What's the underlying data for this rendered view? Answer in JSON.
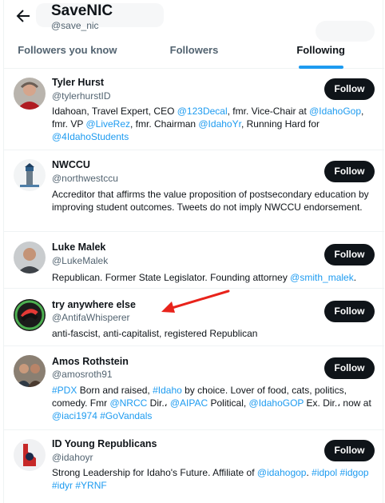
{
  "header": {
    "title": "SaveNIC",
    "handle": "@save_nic"
  },
  "tabs": [
    {
      "label": "Followers you know"
    },
    {
      "label": "Followers"
    },
    {
      "label": "Following"
    }
  ],
  "follow_label": "Follow",
  "users": [
    {
      "name": "Tyler Hurst",
      "handle": "@tylerhurstID",
      "bio": [
        {
          "t": "Idahoan, Travel Expert, CEO "
        },
        {
          "t": "@123Decal",
          "link": true
        },
        {
          "t": ", fmr. Vice-Chair at "
        },
        {
          "t": "@IdahoGop",
          "link": true
        },
        {
          "t": ", fmr. VP "
        },
        {
          "t": "@LiveRez",
          "link": true
        },
        {
          "t": ", fmr. Chairman "
        },
        {
          "t": "@IdahoYr",
          "link": true
        },
        {
          "t": ", Running Hard for "
        },
        {
          "t": "@4IdahoStudents",
          "link": true
        }
      ]
    },
    {
      "name": "NWCCU",
      "handle": "@northwestccu",
      "bio": [
        {
          "t": "Accreditor that affirms the value proposition of postsecondary education by improving student outcomes. Tweets do not imply NWCCU endorsement."
        }
      ]
    },
    {
      "name": "Luke Malek",
      "handle": "@LukeMalek",
      "bio": [
        {
          "t": "Republican. Former State Legislator. Founding attorney "
        },
        {
          "t": "@smith_malek",
          "link": true
        },
        {
          "t": "."
        }
      ]
    },
    {
      "name": "try anywhere else",
      "handle": "@AntifaWhisperer",
      "bio": [
        {
          "t": "anti-fascist, anti-capitalist, registered Republican"
        }
      ]
    },
    {
      "name": "Amos Rothstein",
      "handle": "@amosroth91",
      "bio": [
        {
          "t": "#PDX",
          "link": true
        },
        {
          "t": " Born and raised, "
        },
        {
          "t": "#Idaho",
          "link": true
        },
        {
          "t": " by choice. Lover of food, cats, politics, comedy. Fmr "
        },
        {
          "t": "@NRCC",
          "link": true
        },
        {
          "t": " Dir.، "
        },
        {
          "t": "@AIPAC",
          "link": true
        },
        {
          "t": " Political, "
        },
        {
          "t": "@IdahoGOP",
          "link": true
        },
        {
          "t": " Ex. Dir.، now at "
        },
        {
          "t": "@iaci1974",
          "link": true
        },
        {
          "t": " "
        },
        {
          "t": "#GoVandals",
          "link": true
        }
      ]
    },
    {
      "name": "ID Young Republicans",
      "handle": "@idahoyr",
      "bio": [
        {
          "t": "Strong Leadership for Idaho's Future. Affiliate of "
        },
        {
          "t": "@idahogop",
          "link": true
        },
        {
          "t": ". "
        },
        {
          "t": "#idpol",
          "link": true
        },
        {
          "t": " "
        },
        {
          "t": "#idgop",
          "link": true
        },
        {
          "t": " "
        },
        {
          "t": "#idyr",
          "link": true
        },
        {
          "t": " "
        },
        {
          "t": "#YRNF",
          "link": true
        }
      ]
    }
  ],
  "colors": {
    "link": "#1d9bf0",
    "button": "#0f1419",
    "annotation_arrow": "#e8231b"
  },
  "icons": {
    "back": "arrow-left-icon",
    "annotation": "red-arrow-icon"
  }
}
